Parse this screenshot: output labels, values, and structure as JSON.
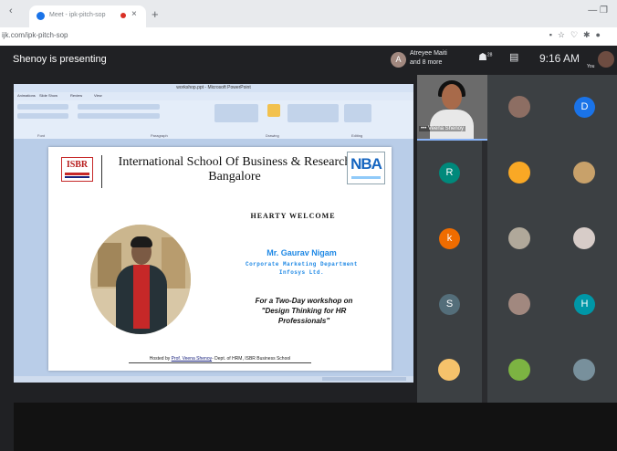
{
  "browser": {
    "tab_title": "Meet - ipk-pitch-sop",
    "new_tab_icon": "+",
    "url": "ijk.com/ipk-pitch-sop",
    "colors": {
      "recording": "#d93025"
    }
  },
  "meet": {
    "presenting_text": "Shenoy is presenting",
    "presenter_initial": "A",
    "presenter_line1": "Atreyee Maiti",
    "presenter_line2": "and 8 more",
    "participant_count": "28",
    "time": "9:16 AM",
    "you_label": "You"
  },
  "ppt": {
    "window_title": "workshop.ppt - Microsoft PowerPoint",
    "menu": [
      "Animations",
      "Slide Show",
      "Review",
      "View"
    ],
    "ribbon_groups": [
      "Font",
      "Paragraph",
      "Drawing",
      "Editing"
    ]
  },
  "slide": {
    "logo_left": "ISBR",
    "school_line1": "International School Of Business & Research",
    "school_line2": "Bangalore",
    "logo_right": "NBA",
    "welcome": "HEARTY WELCOME",
    "guest_name": "Mr. Gaurav Nigam",
    "guest_dept": "Corporate Marketing Department",
    "guest_company": "Infosys Ltd.",
    "workshop_line1": "For a Two-Day workshop  on",
    "workshop_line2": "\"Design Thinking for HR",
    "workshop_line3": "Professionals\"",
    "hosted_prefix": "Hosted by ",
    "hosted_name": "Prof. Veena Shenoy",
    "hosted_suffix": "- Dept. of HRM, ISBR Business School"
  },
  "participants": {
    "speaker_name": "Veena Shenoy",
    "letters": {
      "d": "D",
      "r": "R",
      "k": "k",
      "s": "S",
      "h": "H"
    },
    "colors": {
      "d": "#1a73e8",
      "r": "#00897b",
      "k": "#ef6c00",
      "s": "#546e7a",
      "h": "#0097a7"
    }
  }
}
